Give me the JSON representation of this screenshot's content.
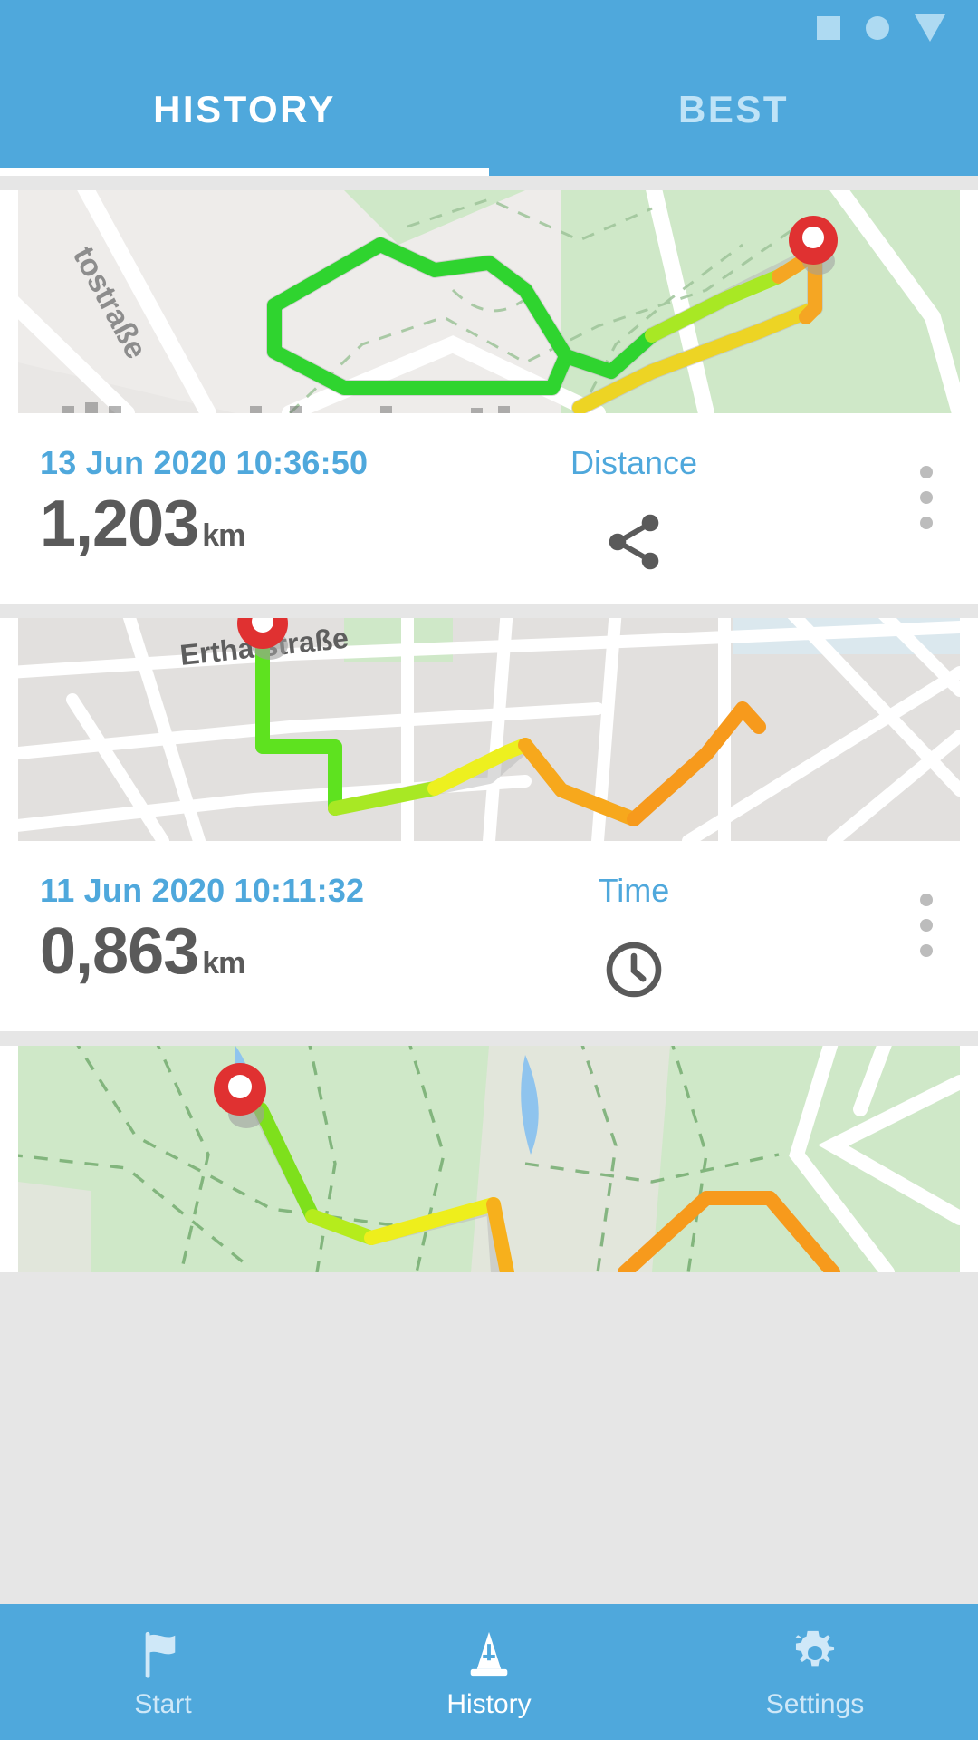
{
  "app": {
    "accent_color": "#4FA8DC",
    "accent_light": "#BFE3F7",
    "value_color": "#5a5a5a"
  },
  "statusbar": {
    "icons": [
      "square-icon",
      "circle-icon",
      "triangle-down-icon"
    ]
  },
  "tabs": [
    {
      "id": "history",
      "label": "HISTORY",
      "active": true
    },
    {
      "id": "best",
      "label": "BEST",
      "active": false
    }
  ],
  "activities": [
    {
      "date": "13 Jun 2020 10:36:50",
      "value": "1,203",
      "unit": "km",
      "metric_label": "Distance",
      "metric_icon": "share-icon",
      "menu_icon": "kebab-menu-icon",
      "map": {
        "street_label": "tostraße",
        "marker": "map-pin-marker",
        "terrain": "park-and-streets"
      }
    },
    {
      "date": "11 Jun 2020 10:11:32",
      "value": "0,863",
      "unit": "km",
      "metric_label": "Time",
      "metric_icon": "clock-icon",
      "menu_icon": "kebab-menu-icon",
      "map": {
        "street_label": "Erthalstraße",
        "marker": "map-pin-marker",
        "terrain": "city-streets"
      }
    },
    {
      "date": "",
      "value": "",
      "unit": "",
      "metric_label": "",
      "metric_icon": "",
      "menu_icon": "",
      "map": {
        "street_label": "",
        "marker": "map-pin-marker",
        "terrain": "forest-trails"
      }
    }
  ],
  "bottomnav": [
    {
      "id": "start",
      "label": "Start",
      "icon": "flag-icon",
      "active": false
    },
    {
      "id": "history",
      "label": "History",
      "icon": "traffic-cone-icon",
      "active": true
    },
    {
      "id": "settings",
      "label": "Settings",
      "icon": "gear-icon",
      "active": false
    }
  ]
}
